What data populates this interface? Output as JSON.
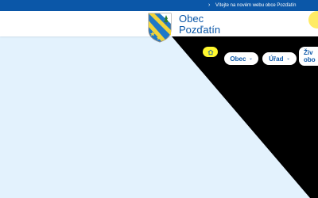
{
  "topbar": {
    "chevron": "›",
    "notice": "Vítejte na novém webu obce Pozďatín"
  },
  "brand": {
    "line1": "Obec",
    "line2": "Pozďatín"
  },
  "nav": {
    "home_icon": "home-icon",
    "items": [
      {
        "label": "Obec"
      },
      {
        "label": "Úřad"
      },
      {
        "label_line1": "Živ",
        "label_line2": "obo"
      }
    ],
    "caret": "⌄"
  },
  "colors": {
    "brand_blue": "#0b57a8",
    "page_bg": "#e3f2fd",
    "accent_yellow": "#fff82e",
    "dark_panel": "#000000"
  }
}
